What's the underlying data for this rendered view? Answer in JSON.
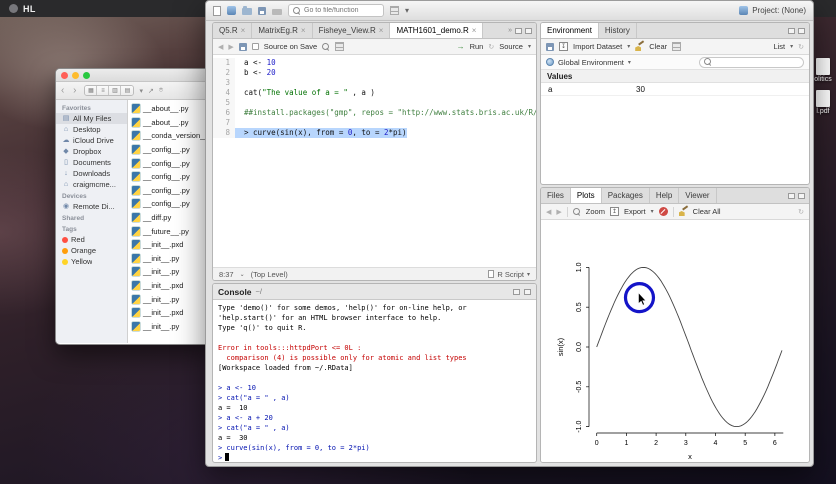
{
  "menubar": {
    "logo": "HL"
  },
  "desktop": {
    "icon1_label": "olitics",
    "icon2_label": "l.pdf"
  },
  "finder": {
    "sidebar": {
      "sections": [
        {
          "title": "Favorites",
          "items": [
            {
              "label": "All My Files",
              "icon": "allfiles",
              "selected": true
            },
            {
              "label": "Desktop",
              "icon": "desktop"
            },
            {
              "label": "iCloud Drive",
              "icon": "cloud"
            },
            {
              "label": "Dropbox",
              "icon": "dropbox"
            },
            {
              "label": "Documents",
              "icon": "documents"
            },
            {
              "label": "Downloads",
              "icon": "downloads"
            },
            {
              "label": "craigmcme...",
              "icon": "home"
            }
          ]
        },
        {
          "title": "Devices",
          "items": [
            {
              "label": "Remote Di...",
              "icon": "disk"
            }
          ]
        },
        {
          "title": "Shared",
          "items": []
        },
        {
          "title": "Tags",
          "items": [
            {
              "label": "Red",
              "dot": "#ff4f42"
            },
            {
              "label": "Orange",
              "dot": "#ff9d0a"
            },
            {
              "label": "Yellow",
              "dot": "#ffd426"
            }
          ]
        }
      ]
    },
    "files": [
      "__about__.py",
      "__about__.py",
      "__conda_version__",
      "__config__.py",
      "__config__.py",
      "__config__.py",
      "__config__.py",
      "__config__.py",
      "__diff.py",
      "__future__.py",
      "__init__.pxd",
      "__init__.py",
      "__init__.py",
      "__init__.pxd",
      "__init__.py",
      "__init__.pxd",
      "__init__.py"
    ]
  },
  "rstudio": {
    "project_label": "Project: (None)",
    "goto_placeholder": "Go to file/function",
    "source": {
      "tabs": [
        {
          "label": "Q5.R"
        },
        {
          "label": "MatrixEg.R"
        },
        {
          "label": "Fisheye_View.R"
        },
        {
          "label": "MATH1601_demo.R",
          "active": true
        }
      ],
      "toolbar": {
        "source_on_save": "Source on Save",
        "run": "Run",
        "source": "Source"
      },
      "lines": [
        {
          "n": 1,
          "tokens": [
            {
              "t": "a <- ",
              "c": "pl"
            },
            {
              "t": "10",
              "c": "num"
            }
          ]
        },
        {
          "n": 2,
          "tokens": [
            {
              "t": "b <- ",
              "c": "pl"
            },
            {
              "t": "20",
              "c": "num"
            }
          ]
        },
        {
          "n": 3,
          "tokens": []
        },
        {
          "n": 4,
          "tokens": [
            {
              "t": "cat(",
              "c": "pl"
            },
            {
              "t": "\"The value of a = \"",
              "c": "str"
            },
            {
              "t": " , a )",
              "c": "pl"
            }
          ]
        },
        {
          "n": 5,
          "tokens": []
        },
        {
          "n": 6,
          "tokens": [
            {
              "t": "##install.packages(\"gmp\", repos = \"http://www.stats.bris.ac.uk/R/\")",
              "c": "com"
            }
          ]
        },
        {
          "n": 7,
          "tokens": []
        },
        {
          "n": 8,
          "sel": true,
          "tokens": [
            {
              "t": "> curve(sin(x), from = ",
              "c": "pl"
            },
            {
              "t": "0",
              "c": "num"
            },
            {
              "t": ", to = ",
              "c": "pl"
            },
            {
              "t": "2",
              "c": "num"
            },
            {
              "t": "*pi)",
              "c": "pl"
            }
          ]
        }
      ],
      "status": {
        "position": "8:37",
        "scope": "(Top Level)",
        "type": "R Script"
      }
    },
    "console": {
      "title": "Console",
      "path": "~/",
      "lines": [
        {
          "t": "Type 'demo()' for some demos, 'help()' for on-line help, or",
          "c": "out"
        },
        {
          "t": "'help.start()' for an HTML browser interface to help.",
          "c": "out"
        },
        {
          "t": "Type 'q()' to quit R.",
          "c": "out"
        },
        {
          "t": "",
          "c": "out"
        },
        {
          "t": "Error in tools:::httpdPort <= 0L :",
          "c": "err"
        },
        {
          "t": "  comparison (4) is possible only for atomic and list types",
          "c": "err"
        },
        {
          "t": "[Workspace loaded from ~/.RData]",
          "c": "out"
        },
        {
          "t": "",
          "c": "out"
        },
        {
          "t": "> a <- 10",
          "c": "in"
        },
        {
          "t": "> cat(\"a = \" , a)",
          "c": "in"
        },
        {
          "t": "a =  10",
          "c": "out"
        },
        {
          "t": "> a <- a + 20",
          "c": "in"
        },
        {
          "t": "> cat(\"a = \" , a)",
          "c": "in"
        },
        {
          "t": "a =  30",
          "c": "out"
        },
        {
          "t": "> curve(sin(x), from = 0, to = 2*pi)",
          "c": "in"
        },
        {
          "t": ">",
          "c": "in",
          "caret": true
        }
      ]
    },
    "environment": {
      "tabs": [
        {
          "label": "Environment",
          "active": true
        },
        {
          "label": "History"
        }
      ],
      "toolbar": {
        "import": "Import Dataset",
        "clear": "Clear",
        "list": "List"
      },
      "scope": "Global Environment",
      "section": "Values",
      "values": [
        {
          "name": "a",
          "value": "30"
        }
      ]
    },
    "plots": {
      "tabs": [
        {
          "label": "Files"
        },
        {
          "label": "Plots",
          "active": true
        },
        {
          "label": "Packages"
        },
        {
          "label": "Help"
        },
        {
          "label": "Viewer"
        }
      ],
      "toolbar": {
        "zoom": "Zoom",
        "export": "Export",
        "clear_all": "Clear All"
      }
    }
  },
  "chart_data": {
    "type": "line",
    "expression": "sin(x)",
    "title": "",
    "xlabel": "x",
    "ylabel": "sin(x)",
    "xlim": [
      0,
      6.283
    ],
    "ylim": [
      -1,
      1
    ],
    "x_ticks": [
      0,
      1,
      2,
      3,
      4,
      5,
      6
    ],
    "y_ticks": [
      -1.0,
      -0.5,
      0.0,
      0.5,
      1.0
    ],
    "curve_color": "#444444",
    "annotation": {
      "shape": "circle",
      "color": "#1414c8",
      "center_x": 1.44,
      "center_y": 0.62,
      "radius_px": 14
    }
  },
  "colors": {
    "selection": "#b8d6fd",
    "console_input": "#0010b0",
    "console_error": "#c40000"
  }
}
